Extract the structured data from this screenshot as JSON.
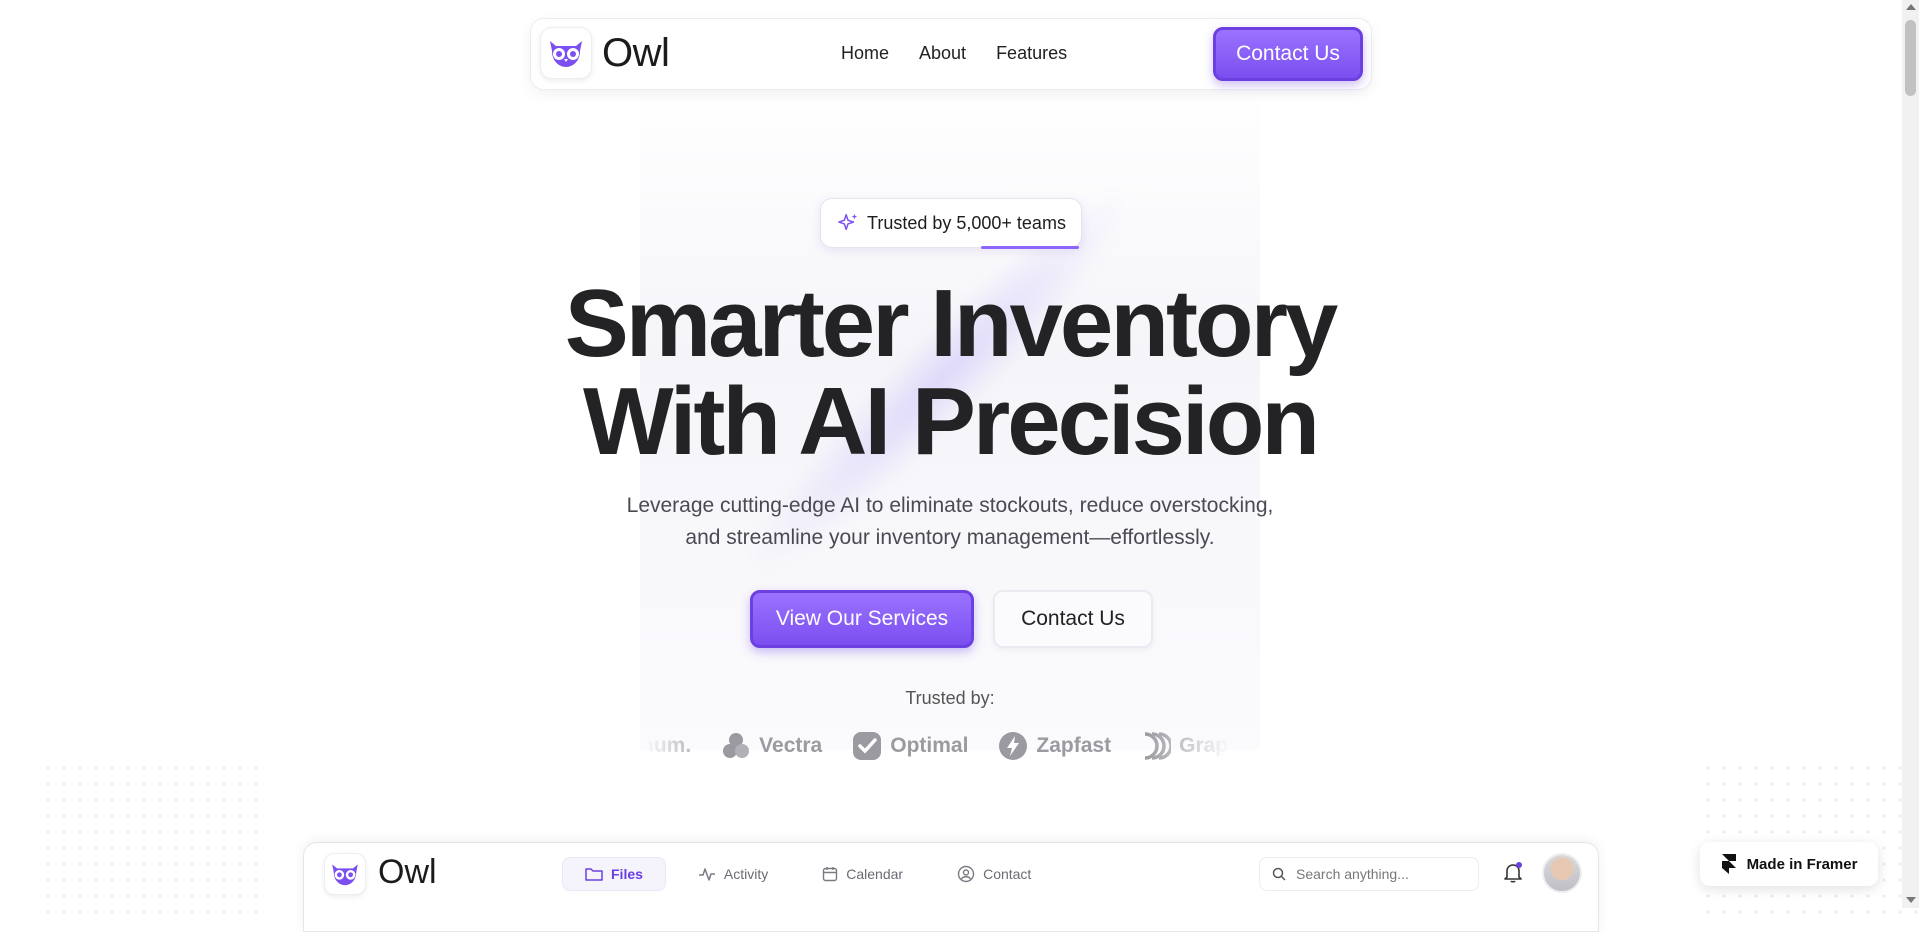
{
  "nav": {
    "brand": "Owl",
    "links": [
      "Home",
      "About",
      "Features"
    ],
    "cta": "Contact Us"
  },
  "hero": {
    "badge": "Trusted by 5,000+ teams",
    "headline_line1": "Smarter Inventory",
    "headline_line2": "With AI Precision",
    "sub_line1": "Leverage cutting-edge AI to eliminate stockouts, reduce overstocking,",
    "sub_line2": "and streamline your inventory management—effortlessly.",
    "primary_button": "View Our Services",
    "secondary_button": "Contact Us"
  },
  "trusted": {
    "label": "Trusted by:",
    "logos": [
      "num.",
      "Vectra",
      "Optimal",
      "Zapfast",
      "Grapho"
    ]
  },
  "preview": {
    "brand": "Owl",
    "tabs": [
      "Files",
      "Activity",
      "Calendar",
      "Contact"
    ],
    "active_tab": "Files",
    "search_placeholder": "Search anything..."
  },
  "framer_badge": "Made in Framer",
  "colors": {
    "accent": "#7b4ff0",
    "text": "#232325",
    "muted": "#9a9aa0"
  }
}
